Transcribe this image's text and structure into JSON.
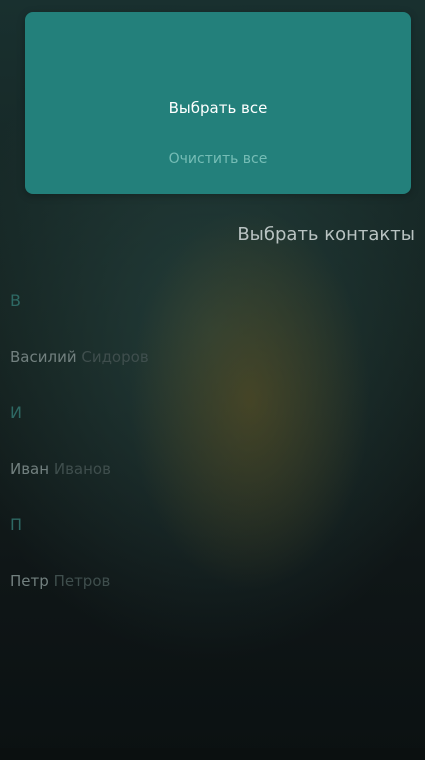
{
  "menu": {
    "select_all": "Выбрать все",
    "clear_all": "Очистить все"
  },
  "header": {
    "title": "Выбрать контакты"
  },
  "contacts": {
    "groups": [
      {
        "letter": "В",
        "first": "Василий",
        "last": "Сидоров"
      },
      {
        "letter": "И",
        "first": "Иван",
        "last": "Иванов"
      },
      {
        "letter": "П",
        "first": "Петр",
        "last": "Петров"
      }
    ]
  },
  "colors": {
    "menu_background": "#23807b",
    "section_letter": "#2e6964",
    "first_name": "#72807f",
    "last_name": "#3f4e4d"
  }
}
